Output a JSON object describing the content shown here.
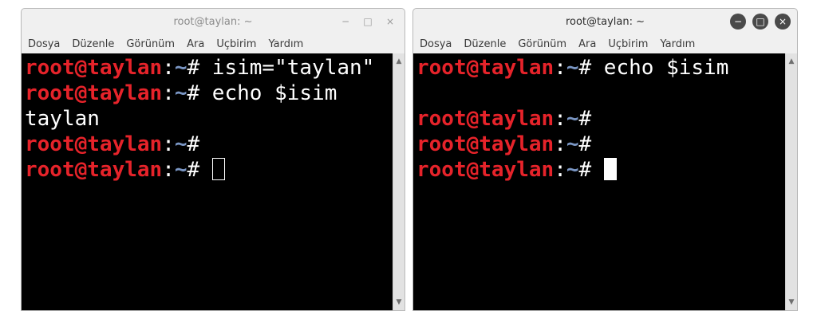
{
  "menu": [
    "Dosya",
    "Düzenle",
    "Görünüm",
    "Ara",
    "Uçbirim",
    "Yardım"
  ],
  "prompt": {
    "user": "root@taylan",
    "colon": ":",
    "path": "~",
    "hash": "#"
  },
  "windows": [
    {
      "title": "root@taylan: ~",
      "lines": [
        {
          "prompt": true,
          "cmd": " isim=\"taylan\""
        },
        {
          "prompt": true,
          "cmd": " echo $isim"
        },
        {
          "prompt": false,
          "cmd": "taylan"
        },
        {
          "prompt": true,
          "cmd": ""
        },
        {
          "prompt": true,
          "cmd": " ",
          "cursor": "hollow"
        }
      ]
    },
    {
      "title": "root@taylan: ~",
      "lines": [
        {
          "prompt": true,
          "cmd": " echo $isim"
        },
        {
          "prompt": false,
          "cmd": ""
        },
        {
          "prompt": true,
          "cmd": ""
        },
        {
          "prompt": true,
          "cmd": ""
        },
        {
          "prompt": true,
          "cmd": " ",
          "cursor": "solid"
        }
      ]
    }
  ],
  "buttons": {
    "minimize": "−",
    "maximize": "□",
    "close": "×"
  },
  "colors": {
    "user": "#e6232a",
    "path": "#7a96c4",
    "terminal_bg": "#000000",
    "text": "#ffffff"
  }
}
